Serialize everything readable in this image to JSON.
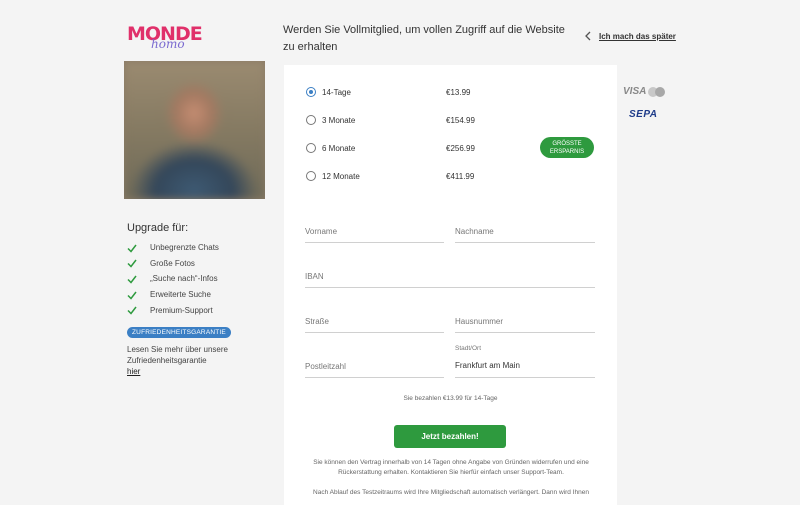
{
  "logo": {
    "main": "MONDE",
    "sub": "homo"
  },
  "header": {
    "headline": "Werden Sie Vollmitglied, um vollen Zugriff auf die Website zu erhalten",
    "later_link": "Ich mach das später"
  },
  "sidebar": {
    "upgrade_title": "Upgrade für:",
    "features": [
      "Unbegrenzte Chats",
      "Große Fotos",
      "„Suche nach“-Infos",
      "Erweiterte Suche",
      "Premium-Support"
    ],
    "badge": "ZUFRIEDENHEITSGARANTIE",
    "guarantee_text": "Lesen Sie mehr über unsere Zufriedenheitsgarantie",
    "guarantee_link": "hier"
  },
  "plans": [
    {
      "label": "14-Tage",
      "price": "€13.99",
      "selected": true
    },
    {
      "label": "3 Monate",
      "price": "€154.99",
      "selected": false
    },
    {
      "label": "6 Monate",
      "price": "€256.99",
      "selected": false
    },
    {
      "label": "12 Monate",
      "price": "€411.99",
      "selected": false
    }
  ],
  "saving_badge": {
    "line1": "GRÖSSTE",
    "line2": "ERSPARNIS"
  },
  "form": {
    "first_name_placeholder": "Vorname",
    "last_name_placeholder": "Nachname",
    "iban_placeholder": "IBAN",
    "street_placeholder": "Straße",
    "house_number_placeholder": "Hausnummer",
    "postal_code_placeholder": "Postleitzahl",
    "city_label": "Stadt/Ort",
    "city_value": "Frankfurt am Main"
  },
  "payment": {
    "note": "Sie bezahlen €13.99 für 14-Tage",
    "button_label": "Jetzt bezahlen!",
    "legal_text": "Sie können den Vertrag innerhalb von 14 Tagen ohne Angabe von Gründen widerrufen und eine Rückerstattung erhalten. Kontaktieren Sie hierfür einfach unser Support-Team.",
    "legal_text_2": "Nach Ablauf des Testzeitraums wird Ihre Mitgliedschaft automatisch verlängert. Dann wird Ihnen"
  },
  "payment_logos": {
    "visa": "VISA",
    "sepa": "SEPA"
  },
  "colors": {
    "accent": "#2e9a3e",
    "badge_blue": "#3b7fc4",
    "logo_pink": "#e0306a",
    "logo_orange": "#f29a1f"
  }
}
